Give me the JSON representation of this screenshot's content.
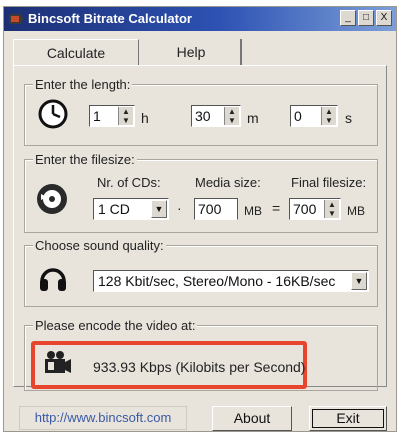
{
  "window": {
    "title": "Bincsoft Bitrate Calculator",
    "min_glyph": "_",
    "max_glyph": "□",
    "close_glyph": "X"
  },
  "tabs": [
    {
      "label": "Calculate",
      "active": true
    },
    {
      "label": "Help",
      "active": false
    }
  ],
  "length": {
    "legend": "Enter the length:",
    "hours": {
      "value": "1",
      "unit": "h"
    },
    "minutes": {
      "value": "30",
      "unit": "m"
    },
    "seconds": {
      "value": "0",
      "unit": "s"
    }
  },
  "filesize": {
    "legend": "Enter the filesize:",
    "cds_label": "Nr. of CDs:",
    "cds_value": "1 CD",
    "times": "·",
    "media_label": "Media size:",
    "media_value": "700",
    "media_unit": "MB",
    "equals": "=",
    "final_label": "Final filesize:",
    "final_value": "700",
    "final_unit": "MB"
  },
  "quality": {
    "legend": "Choose sound quality:",
    "selected": "128 Kbit/sec, Stereo/Mono - 16KB/sec"
  },
  "encode": {
    "legend": "Please encode the video at:",
    "result": "933.93  Kbps (Kilobits per Second)"
  },
  "footer": {
    "link": "http://www.bincsoft.com",
    "about": "About",
    "exit": "Exit"
  },
  "icons": {
    "app": "app-icon",
    "clock": "clock-icon",
    "disc": "cd-disc-icon",
    "headphones": "headphones-icon",
    "film": "film-camera-icon"
  },
  "colors": {
    "titlebar": "#1c2f74",
    "highlight": "#e8452e",
    "link": "#3a5aa6"
  }
}
